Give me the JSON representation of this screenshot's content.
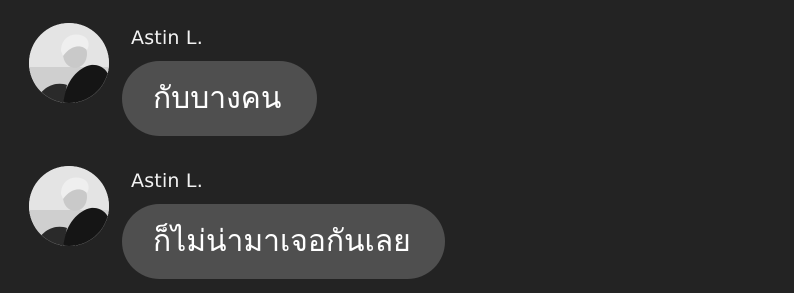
{
  "messages": [
    {
      "sender": "Astin L.",
      "text": "กับบางคน",
      "avatar_icon": "user-photo-avatar"
    },
    {
      "sender": "Astin L.",
      "text": "ก็ไม่น่ามาเจอกันเลย",
      "avatar_icon": "user-photo-avatar"
    }
  ],
  "colors": {
    "background": "#232323",
    "bubble": "#4f4f4f",
    "text": "#ffffff"
  }
}
